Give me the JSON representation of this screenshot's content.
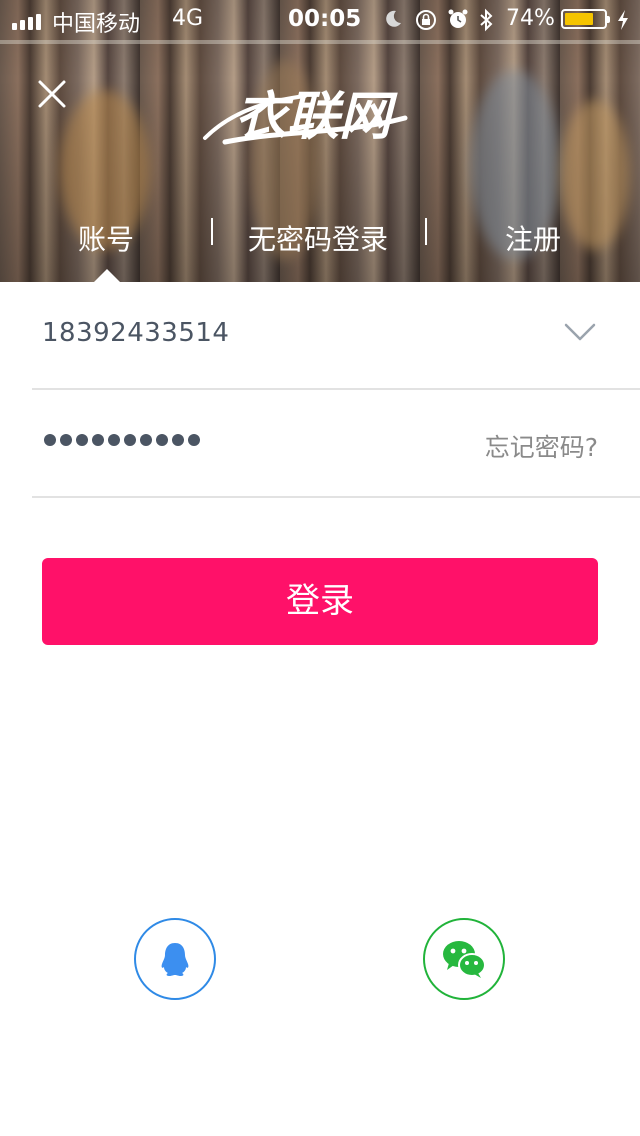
{
  "status_bar": {
    "carrier": "中国移动",
    "network": "4G",
    "time": "00:05",
    "battery_percent_label": "74%",
    "battery_level": 0.74,
    "battery_color": "#f5c400"
  },
  "header": {
    "logo_text": "衣联网",
    "close_icon": "close-icon"
  },
  "tabs": [
    {
      "label": "账号",
      "selected": true
    },
    {
      "label": "无密码登录",
      "selected": false
    },
    {
      "label": "注册",
      "selected": false
    }
  ],
  "form": {
    "username_value": "18392433514",
    "password_dot_count": 10,
    "forgot_label": "忘记密码?",
    "login_label": "登录"
  },
  "social": [
    {
      "icon": "qq-icon",
      "color": "#2f8ae6"
    },
    {
      "icon": "wechat-icon",
      "color": "#21b33a"
    }
  ],
  "colors": {
    "accent": "#ff1169"
  }
}
